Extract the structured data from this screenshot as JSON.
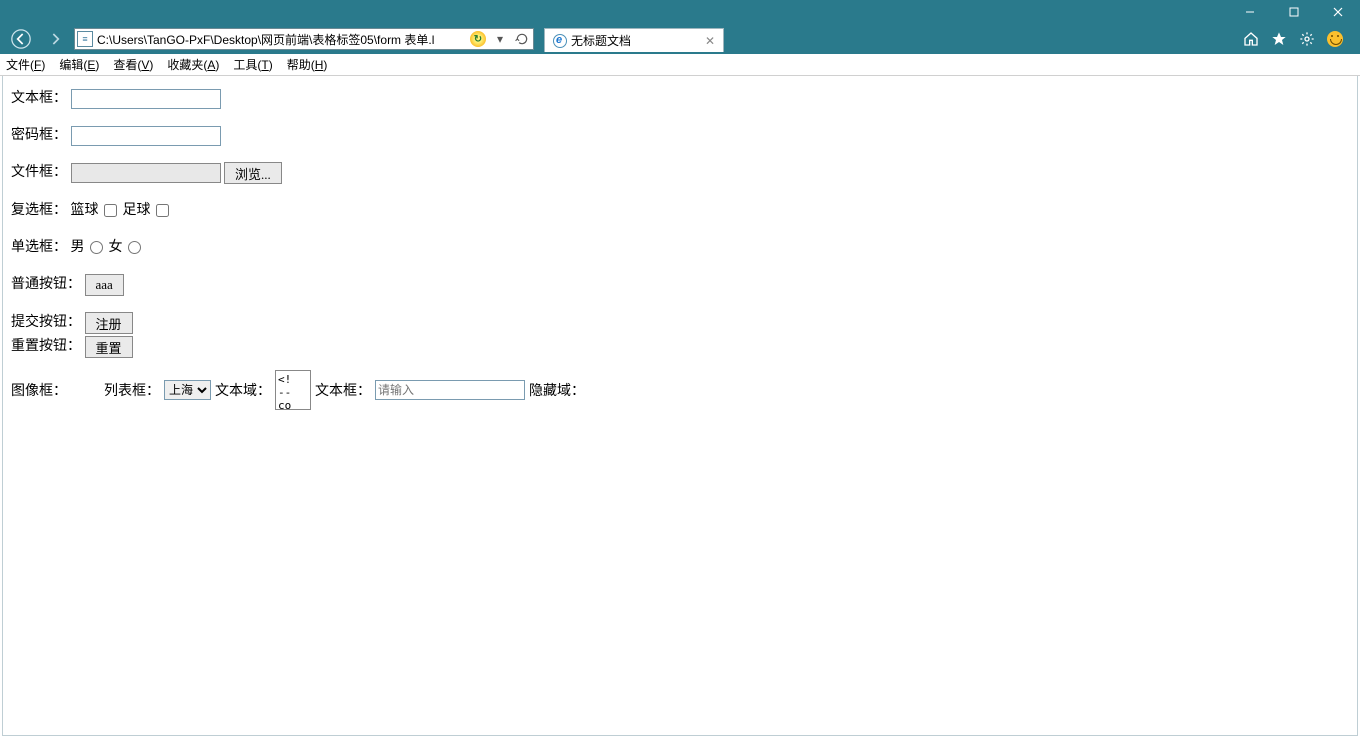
{
  "window": {
    "address": "C:\\Users\\TanGO-PxF\\Desktop\\网页前端\\表格标签05\\form 表单.l",
    "tab_title": "无标题文档"
  },
  "menu": {
    "file": "文件(F)",
    "edit": "编辑(E)",
    "view": "查看(V)",
    "favorites": "收藏夹(A)",
    "tools": "工具(T)",
    "help": "帮助(H)"
  },
  "form": {
    "text_label": "文本框：",
    "password_label": "密码框：",
    "file_label": "文件框：",
    "file_browse": "浏览...",
    "checkbox_label": "复选框：",
    "checkbox_opt1": "篮球",
    "checkbox_opt2": "足球",
    "radio_label": "单选框：",
    "radio_opt1": "男",
    "radio_opt2": "女",
    "button_label": "普通按钮：",
    "button_text": "aaa",
    "submit_label": "提交按钮：",
    "submit_text": "注册",
    "reset_label": "重置按钮：",
    "reset_text": "重置",
    "image_label": "图像框：",
    "list_label": "列表框：",
    "list_selected": "上海",
    "textarea_label": "文本域：",
    "textarea_value": "<!\n--\nco",
    "text2_label": "文本框：",
    "text2_placeholder": "请输入",
    "hidden_label": "隐藏域："
  }
}
